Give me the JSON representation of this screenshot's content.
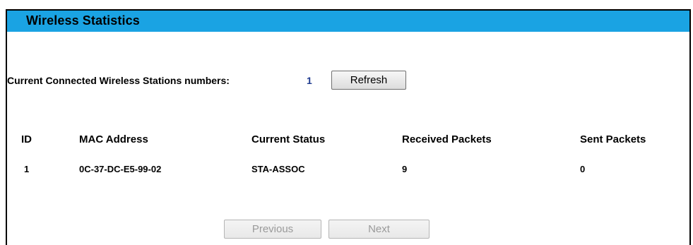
{
  "header": {
    "title": "Wireless Statistics"
  },
  "stations": {
    "label": "Current Connected Wireless Stations numbers:",
    "count": "1",
    "refresh_label": "Refresh"
  },
  "table": {
    "columns": [
      "ID",
      "MAC Address",
      "Current Status",
      "Received Packets",
      "Sent Packets"
    ],
    "rows": [
      [
        "1",
        "0C-37-DC-E5-99-02",
        "STA-ASSOC",
        "9",
        "0"
      ]
    ]
  },
  "pagination": {
    "previous_label": "Previous",
    "next_label": "Next"
  },
  "colors": {
    "header_bg": "#1aa3e3",
    "count_text": "#1f3b8f"
  }
}
